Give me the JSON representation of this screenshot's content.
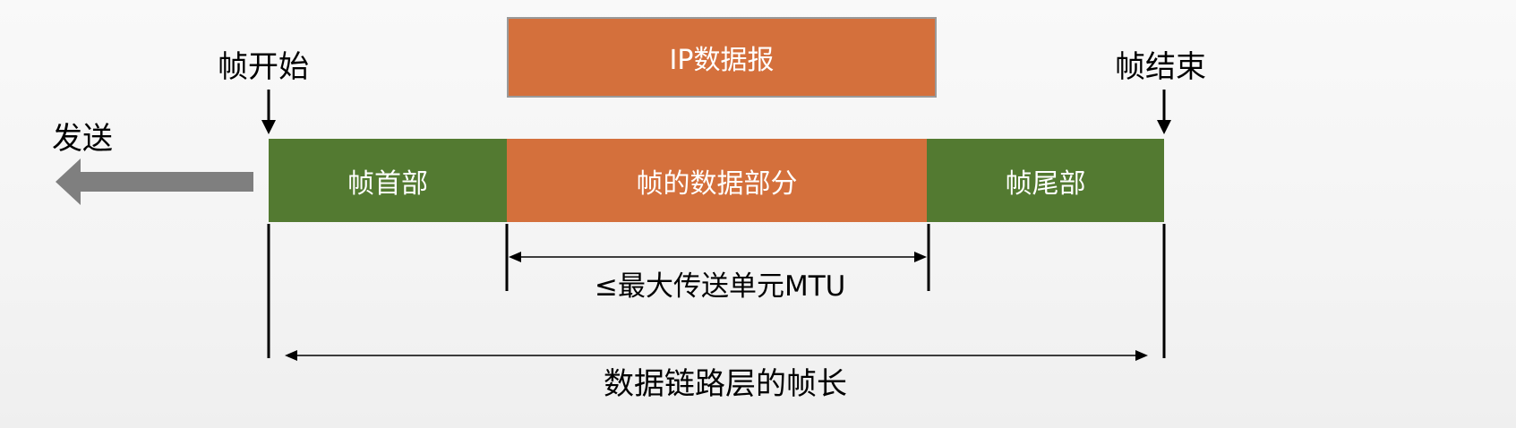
{
  "ip_datagram": {
    "label": "IP数据报",
    "color": "#d4703c"
  },
  "frame_start": {
    "label": "帧开始"
  },
  "frame_end": {
    "label": "帧结束"
  },
  "send": {
    "label": "发送"
  },
  "frame": {
    "header": {
      "label": "帧首部",
      "color": "#537a31"
    },
    "data": {
      "label": "帧的数据部分",
      "color": "#d4703c"
    },
    "trailer": {
      "label": "帧尾部",
      "color": "#537a31"
    }
  },
  "mtu": {
    "label": "≤最大传送单元MTU"
  },
  "frame_length": {
    "label": "数据链路层的帧长"
  }
}
